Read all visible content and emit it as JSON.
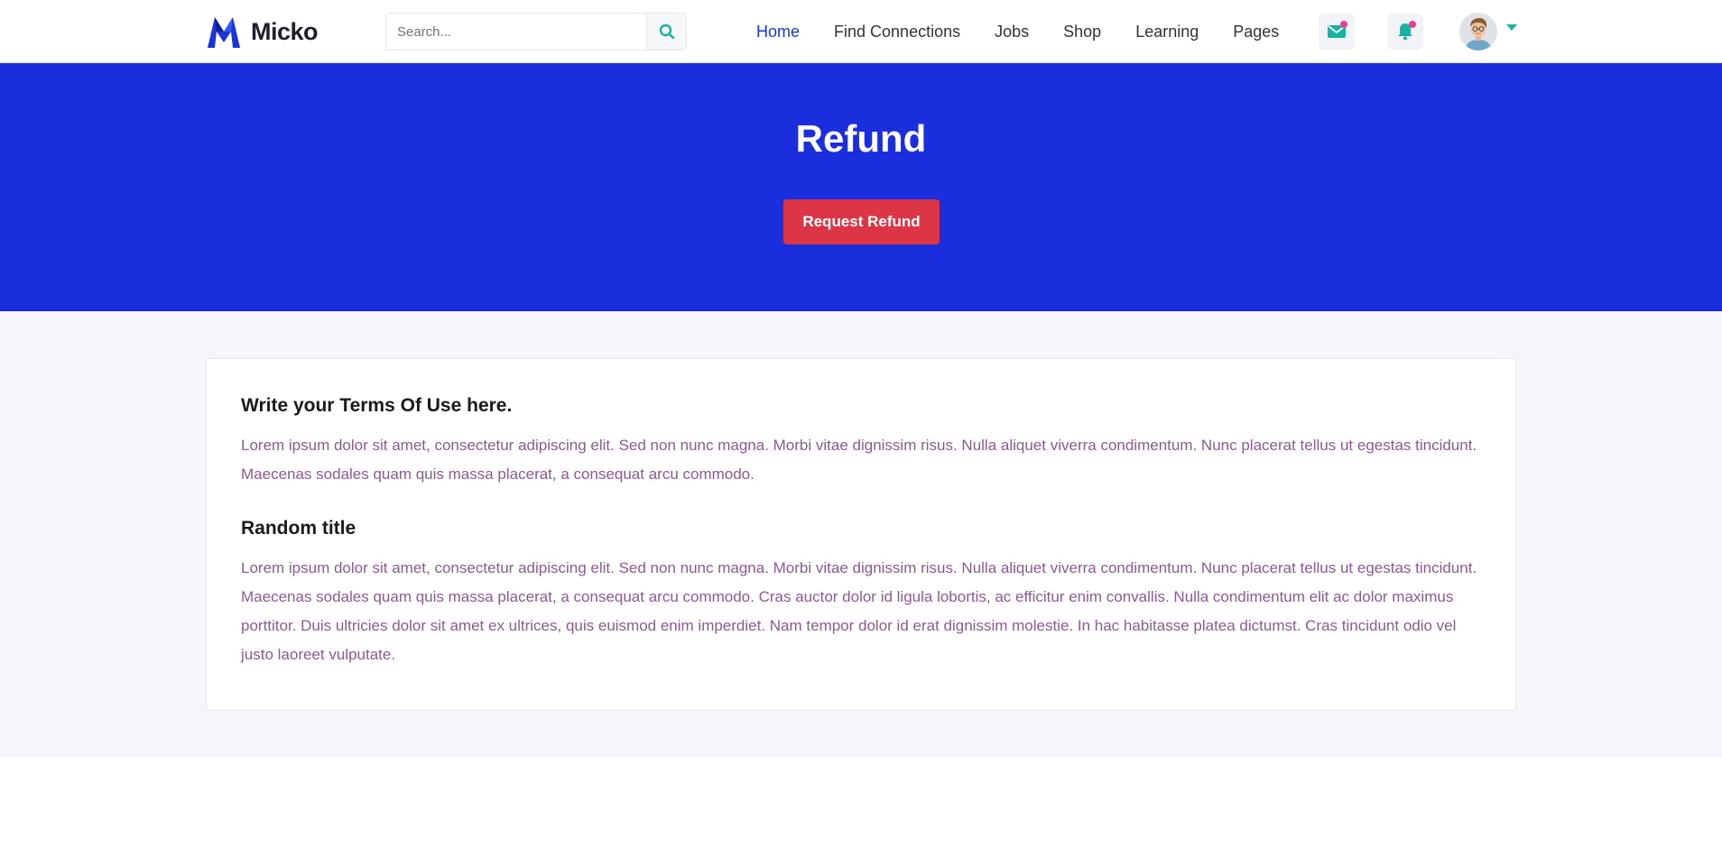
{
  "brand": {
    "name": "Micko"
  },
  "search": {
    "placeholder": "Search..."
  },
  "nav": {
    "items": [
      {
        "label": "Home",
        "active": true
      },
      {
        "label": "Find Connections"
      },
      {
        "label": "Jobs"
      },
      {
        "label": "Shop"
      },
      {
        "label": "Learning"
      },
      {
        "label": "Pages"
      }
    ]
  },
  "icons": {
    "search": "search-icon",
    "mail": "mail-icon",
    "bell": "bell-icon",
    "caret": "caret-down-icon"
  },
  "colors": {
    "accent": "#1a34d8",
    "hero_bg": "#1a2ede",
    "danger": "#dc3545",
    "teal": "#19b3a6",
    "badge": "#e83e8c",
    "body_text": "#8c5a92"
  },
  "hero": {
    "title": "Refund",
    "button_label": "Request Refund"
  },
  "sections": [
    {
      "title": "Write your Terms Of Use here.",
      "body": "Lorem ipsum dolor sit amet, consectetur adipiscing elit. Sed non nunc magna. Morbi vitae dignissim risus. Nulla aliquet viverra condimentum. Nunc placerat tellus ut egestas tincidunt. Maecenas sodales quam quis massa placerat, a consequat arcu commodo."
    },
    {
      "title": "Random title",
      "body": "Lorem ipsum dolor sit amet, consectetur adipiscing elit. Sed non nunc magna. Morbi vitae dignissim risus. Nulla aliquet viverra condimentum. Nunc placerat tellus ut egestas tincidunt. Maecenas sodales quam quis massa placerat, a consequat arcu commodo. Cras auctor dolor id ligula lobortis, ac efficitur enim convallis. Nulla condimentum elit ac dolor maximus porttitor. Duis ultricies dolor sit amet ex ultrices, quis euismod enim imperdiet. Nam tempor dolor id erat dignissim molestie. In hac habitasse platea dictumst. Cras tincidunt odio vel justo laoreet vulputate."
    }
  ]
}
